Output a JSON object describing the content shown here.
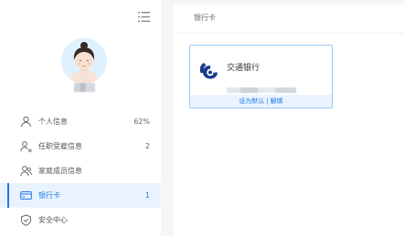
{
  "header": {
    "title": "银行卡"
  },
  "sidebar": {
    "items": [
      {
        "label": "个人信息",
        "count": "62%"
      },
      {
        "label": "任职受雇信息",
        "count": "2"
      },
      {
        "label": "家庭成员信息",
        "count": ""
      },
      {
        "label": "银行卡",
        "count": "1",
        "active": true
      },
      {
        "label": "安全中心",
        "count": ""
      }
    ]
  },
  "card": {
    "bank_name": "交通银行",
    "actions": {
      "set_default": "设为默认",
      "separator": "|",
      "unbind": "解绑"
    }
  },
  "colors": {
    "accent": "#1f78e8",
    "active_bg": "#e9f3ff",
    "card_border": "#9cc7f3",
    "bank_logo": "#1b3b8f"
  },
  "icons": [
    "menu-icon",
    "user-icon",
    "user-lines-icon",
    "family-icon",
    "bank-card-icon",
    "shield-icon",
    "bank-logo-icon"
  ]
}
